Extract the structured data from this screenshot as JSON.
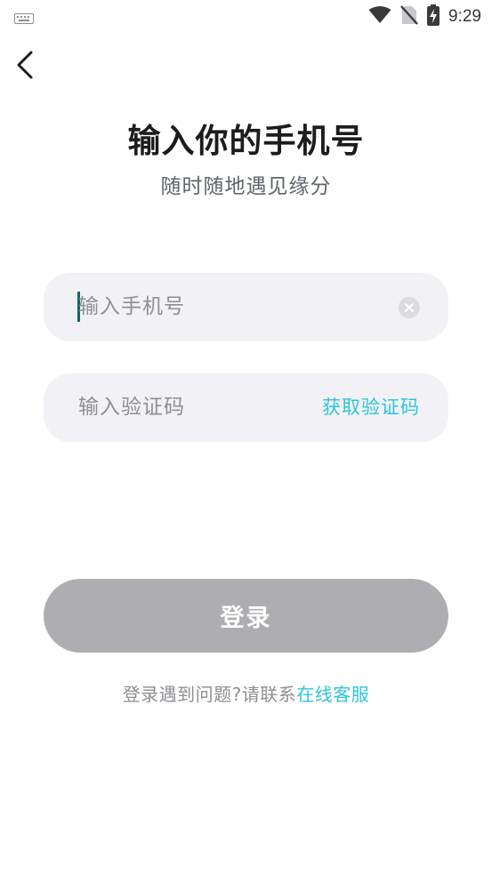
{
  "status_bar": {
    "time": "9:29",
    "icons": [
      "keyboard-icon",
      "wifi-icon",
      "no-sim-icon",
      "battery-charging-icon"
    ]
  },
  "nav": {
    "back_icon": "chevron-left-icon"
  },
  "header": {
    "title": "输入你的手机号",
    "subtitle": "随时随地遇见缘分"
  },
  "phone_input": {
    "placeholder": "输入手机号",
    "value": "",
    "clear_icon": "clear-circle-icon"
  },
  "code_input": {
    "placeholder": "输入验证码",
    "value": "",
    "get_code_label": "获取验证码"
  },
  "login_button": {
    "label": "登录"
  },
  "help": {
    "text": "登录遇到问题?请联系",
    "link": "在线客服"
  },
  "colors": {
    "accent": "#2bc6d9",
    "caret": "#0b6b5f",
    "field_bg": "#f2f2f6",
    "button_disabled": "#aeaeb2"
  }
}
